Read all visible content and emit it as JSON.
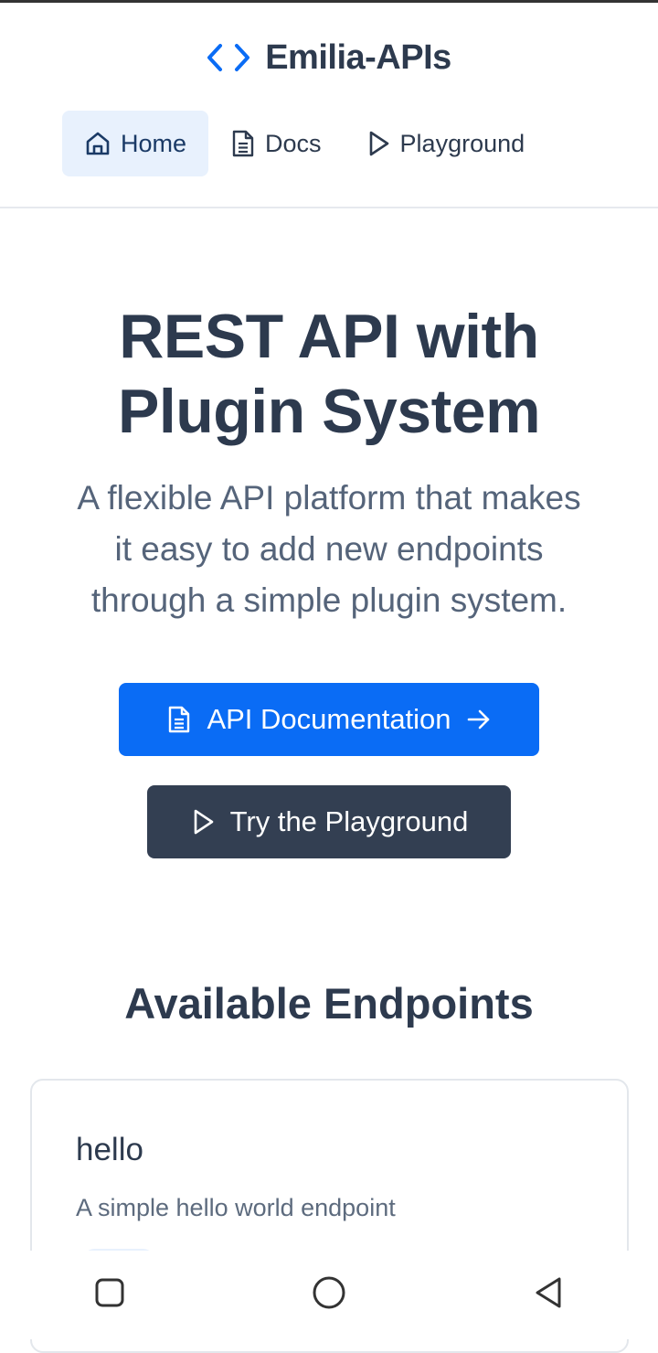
{
  "app": {
    "title": "Emilia-APIs"
  },
  "nav": {
    "home": "Home",
    "docs": "Docs",
    "playground": "Playground"
  },
  "hero": {
    "title_line1": "REST API with",
    "title_line2": "Plugin System",
    "subtitle_line1": "A flexible API platform that makes",
    "subtitle_line2": "it easy to add new endpoints",
    "subtitle_line3": "through a simple plugin system.",
    "primary_button": "API Documentation",
    "secondary_button": "Try the Playground"
  },
  "endpoints": {
    "section_title": "Available Endpoints",
    "items": [
      {
        "name": "hello",
        "description": "A simple hello world endpoint"
      }
    ]
  },
  "colors": {
    "accent": "#0a6cf5",
    "dark_button": "#333f52",
    "text": "#2d3a4e",
    "nav_active_bg": "#e8f1fd"
  },
  "icons": {
    "brand": "code-icon",
    "home": "home-icon",
    "docs": "document-icon",
    "playground": "play-icon",
    "arrow": "arrow-right-icon",
    "system": [
      "recent-apps-icon",
      "home-circle-icon",
      "back-icon"
    ]
  }
}
